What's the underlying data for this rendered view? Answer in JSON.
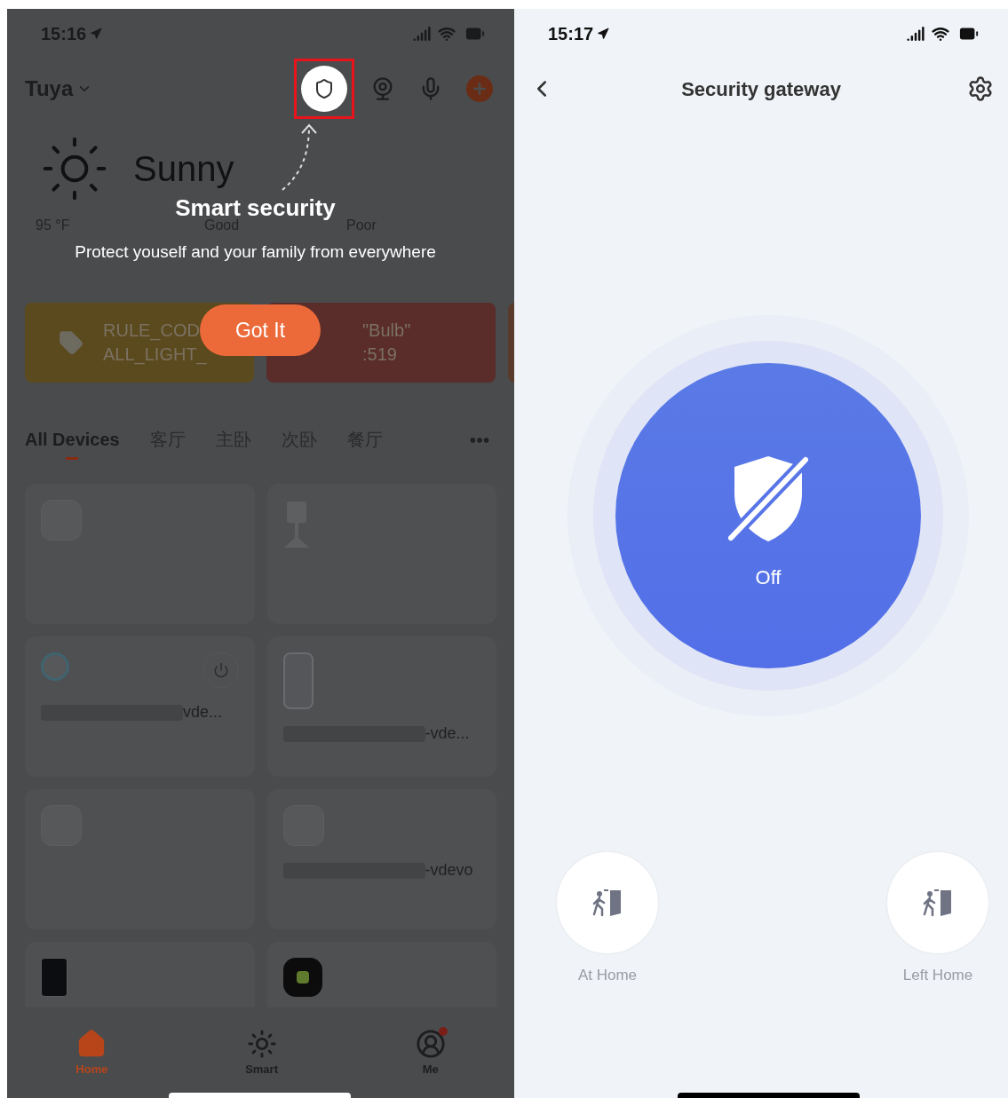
{
  "left_screen": {
    "status_bar": {
      "time": "15:16"
    },
    "header": {
      "home_name": "Tuya"
    },
    "weather": {
      "condition": "Sunny",
      "stats": [
        "95 °F",
        "Good",
        "Poor"
      ]
    },
    "tooltip": {
      "title": "Smart security",
      "description": "Protect youself and your family from everywhere",
      "button": "Got It"
    },
    "scenes": [
      {
        "lines": [
          "RULE_COD",
          "ALL_LIGHT_"
        ],
        "color": "#5b4a1d"
      },
      {
        "lines": [
          "\"Bulb\"",
          ":519"
        ],
        "color": "#5a2c2a"
      }
    ],
    "room_tabs": [
      {
        "label": "All Devices",
        "selected": true
      },
      {
        "label": "客厅",
        "selected": false
      },
      {
        "label": "主卧",
        "selected": false
      },
      {
        "label": "次卧",
        "selected": false
      },
      {
        "label": "餐厅",
        "selected": false
      }
    ],
    "devices": [
      {
        "kind": "hub"
      },
      {
        "kind": "camera"
      },
      {
        "kind": "plug",
        "name": "vde..."
      },
      {
        "kind": "socket",
        "name": "-vde..."
      },
      {
        "kind": "hub"
      },
      {
        "kind": "hub",
        "name": "-vdevo"
      },
      {
        "kind": "keypad"
      },
      {
        "kind": "sensor"
      }
    ],
    "bottom_nav": [
      {
        "label": "Home",
        "kind": "home",
        "selected": true
      },
      {
        "label": "Smart",
        "kind": "smart",
        "selected": false
      },
      {
        "label": "Me",
        "kind": "profile",
        "selected": false
      }
    ]
  },
  "right_screen": {
    "status_bar": {
      "time": "15:17"
    },
    "title": "Security gateway",
    "arm_button": {
      "label": "Off"
    },
    "modes": [
      {
        "label": "At Home"
      },
      {
        "label": "Left Home"
      }
    ]
  }
}
